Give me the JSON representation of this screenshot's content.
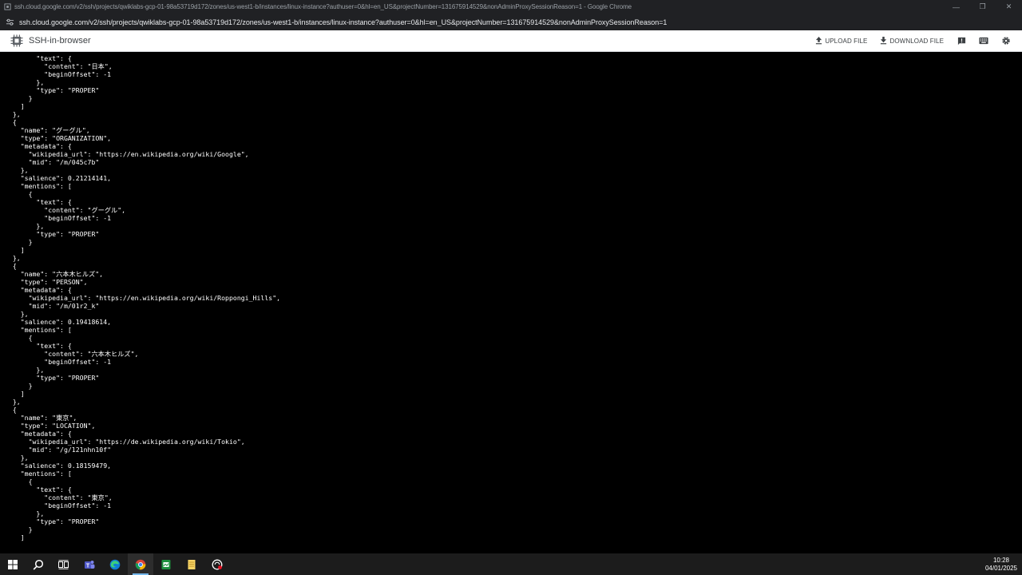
{
  "window": {
    "title": "ssh.cloud.google.com/v2/ssh/projects/qwiklabs-gcp-01-98a53719d172/zones/us-west1-b/instances/linux-instance?authuser=0&hl=en_US&projectNumber=131675914529&nonAdminProxySessionReason=1 - Google Chrome",
    "minimize": "—",
    "restore": "❐",
    "close": "✕"
  },
  "address": {
    "url": "ssh.cloud.google.com/v2/ssh/projects/qwiklabs-gcp-01-98a53719d172/zones/us-west1-b/instances/linux-instance?authuser=0&hl=en_US&projectNumber=131675914529&nonAdminProxySessionReason=1"
  },
  "toolbar": {
    "app_title": "SSH-in-browser",
    "upload_label": "UPLOAD FILE",
    "download_label": "DOWNLOAD FILE"
  },
  "terminal": {
    "lines": [
      "        \"text\": {",
      "          \"content\": \"日本\",",
      "          \"beginOffset\": -1",
      "        },",
      "        \"type\": \"PROPER\"",
      "      }",
      "    ]",
      "  },",
      "  {",
      "    \"name\": \"グーグル\",",
      "    \"type\": \"ORGANIZATION\",",
      "    \"metadata\": {",
      "      \"wikipedia_url\": \"https://en.wikipedia.org/wiki/Google\",",
      "      \"mid\": \"/m/045c7b\"",
      "    },",
      "    \"salience\": 0.21214141,",
      "    \"mentions\": [",
      "      {",
      "        \"text\": {",
      "          \"content\": \"グーグル\",",
      "          \"beginOffset\": -1",
      "        },",
      "        \"type\": \"PROPER\"",
      "      }",
      "    ]",
      "  },",
      "  {",
      "    \"name\": \"六本木ヒルズ\",",
      "    \"type\": \"PERSON\",",
      "    \"metadata\": {",
      "      \"wikipedia_url\": \"https://en.wikipedia.org/wiki/Roppongi_Hills\",",
      "      \"mid\": \"/m/01r2_k\"",
      "    },",
      "    \"salience\": 0.19418614,",
      "    \"mentions\": [",
      "      {",
      "        \"text\": {",
      "          \"content\": \"六本木ヒルズ\",",
      "          \"beginOffset\": -1",
      "        },",
      "        \"type\": \"PROPER\"",
      "      }",
      "    ]",
      "  },",
      "  {",
      "    \"name\": \"東京\",",
      "    \"type\": \"LOCATION\",",
      "    \"metadata\": {",
      "      \"wikipedia_url\": \"https://de.wikipedia.org/wiki/Tokio\",",
      "      \"mid\": \"/g/121nhn10f\"",
      "    },",
      "    \"salience\": 0.18159479,",
      "    \"mentions\": [",
      "      {",
      "        \"text\": {",
      "          \"content\": \"東京\",",
      "          \"beginOffset\": -1",
      "        },",
      "        \"type\": \"PROPER\"",
      "      }",
      "    ]"
    ]
  },
  "taskbar": {
    "time": "10:28",
    "date": "04/01/2025"
  },
  "colors": {
    "chrome_dark": "#202124",
    "terminal_bg": "#000000",
    "terminal_fg": "#ffffff",
    "taskbar_bg": "#1c1c1c",
    "accent": "#76b9ed"
  }
}
